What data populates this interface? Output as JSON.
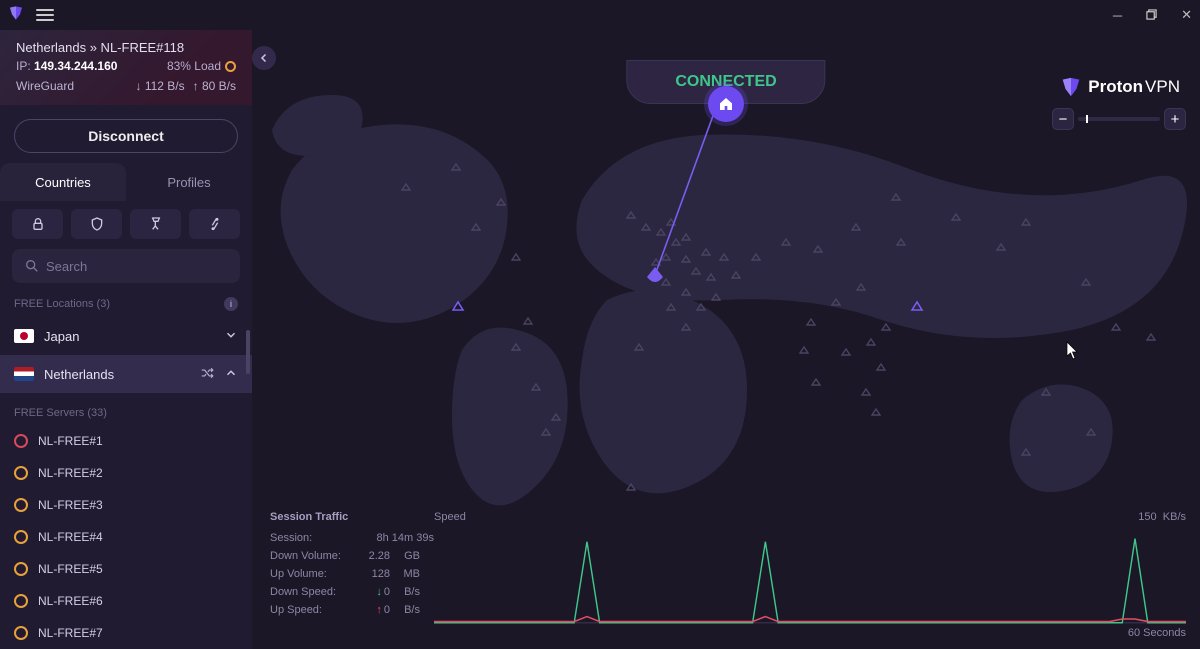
{
  "connection": {
    "title": "Netherlands » NL-FREE#118",
    "ip_prefix": "IP: ",
    "ip": "149.34.244.160",
    "load": "83% Load",
    "protocol": "WireGuard",
    "down_rate": "112 B/s",
    "up_rate": "80 B/s",
    "disconnect_label": "Disconnect"
  },
  "tabs": {
    "countries": "Countries",
    "profiles": "Profiles"
  },
  "search": {
    "placeholder": "Search"
  },
  "free_locations": {
    "label": "FREE Locations (3)"
  },
  "countries": [
    {
      "name": "Japan",
      "flag": "jp",
      "selected": false
    },
    {
      "name": "Netherlands",
      "flag": "nl",
      "selected": true
    }
  ],
  "free_servers": {
    "label": "FREE Servers (33)",
    "items": [
      {
        "name": "NL-FREE#1",
        "state": "red"
      },
      {
        "name": "NL-FREE#2",
        "state": "orange"
      },
      {
        "name": "NL-FREE#3",
        "state": "orange"
      },
      {
        "name": "NL-FREE#4",
        "state": "orange"
      },
      {
        "name": "NL-FREE#5",
        "state": "orange"
      },
      {
        "name": "NL-FREE#6",
        "state": "orange"
      },
      {
        "name": "NL-FREE#7",
        "state": "orange"
      }
    ]
  },
  "status_banner": "CONNECTED",
  "brand": {
    "name": "Proton",
    "suffix": "VPN"
  },
  "traffic": {
    "title": "Session Traffic",
    "speed_label": "Speed",
    "session_label": "Session:",
    "session_value": "8h 14m 39s",
    "rows": [
      {
        "label": "Down Volume:",
        "value": "2.28",
        "unit": "GB"
      },
      {
        "label": "Up Volume:",
        "value": "128",
        "unit": "MB"
      },
      {
        "label": "Down Speed:",
        "value": "0",
        "unit": "B/s",
        "arrow": "down"
      },
      {
        "label": "Up Speed:",
        "value": "0",
        "unit": "B/s",
        "arrow": "up"
      }
    ],
    "speed_max": "150",
    "speed_unit": "KB/s",
    "xaxis": "60 Seconds"
  },
  "chart_data": {
    "type": "line",
    "xlabel": "60 Seconds",
    "ylabel": "KB/s",
    "ylim": [
      0,
      150
    ],
    "series": [
      {
        "name": "down",
        "color": "#3fc78a",
        "values": [
          0,
          0,
          0,
          0,
          0,
          0,
          0,
          0,
          0,
          0,
          0,
          0,
          130,
          0,
          0,
          0,
          0,
          0,
          0,
          0,
          0,
          0,
          0,
          0,
          0,
          0,
          130,
          0,
          0,
          0,
          0,
          0,
          0,
          0,
          0,
          0,
          0,
          0,
          0,
          0,
          0,
          0,
          0,
          0,
          0,
          0,
          0,
          0,
          0,
          0,
          0,
          0,
          0,
          0,
          0,
          135,
          0,
          0,
          0,
          0
        ]
      },
      {
        "name": "up",
        "color": "#e14f63",
        "values": [
          2,
          2,
          2,
          2,
          2,
          2,
          2,
          2,
          2,
          2,
          2,
          2,
          10,
          2,
          2,
          2,
          2,
          2,
          2,
          2,
          2,
          2,
          2,
          2,
          2,
          2,
          10,
          2,
          2,
          2,
          2,
          2,
          2,
          2,
          2,
          2,
          2,
          2,
          2,
          2,
          2,
          2,
          2,
          2,
          2,
          2,
          2,
          2,
          2,
          2,
          2,
          2,
          2,
          2,
          6,
          6,
          2,
          2,
          2,
          2
        ]
      }
    ]
  }
}
